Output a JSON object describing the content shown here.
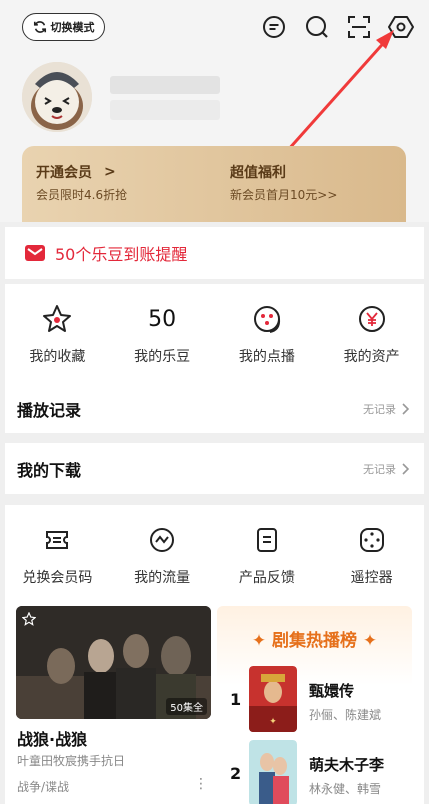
{
  "header": {
    "mode_switch_label": "切换模式",
    "icons": [
      "message-icon",
      "search-icon",
      "scan-icon",
      "settings-icon"
    ]
  },
  "vip": {
    "open_title": "开通会员",
    "open_arrow": ">",
    "open_sub": "会员限时4.6折抢",
    "benefit_title": "超值福利",
    "benefit_sub": "新会员首月10元>>"
  },
  "reminder": {
    "text": "50个乐豆到账提醒"
  },
  "quick": [
    {
      "label": "我的收藏",
      "icon": "star-icon"
    },
    {
      "label": "我的乐豆",
      "value": "50"
    },
    {
      "label": "我的点播",
      "icon": "film-reel-icon"
    },
    {
      "label": "我的资产",
      "icon": "yen-coin-icon"
    }
  ],
  "history": {
    "title": "播放记录",
    "status": "无记录"
  },
  "downloads": {
    "title": "我的下载",
    "status": "无记录"
  },
  "tools": [
    {
      "label": "兑换会员码",
      "icon": "ticket-icon"
    },
    {
      "label": "我的流量",
      "icon": "traffic-icon"
    },
    {
      "label": "产品反馈",
      "icon": "feedback-icon"
    },
    {
      "label": "遥控器",
      "icon": "remote-icon"
    }
  ],
  "featured": {
    "badge": "50集全",
    "title": "战狼·战狼",
    "desc": "叶童田牧宸携手抗日",
    "tags": "战争/谍战",
    "more": "⋮"
  },
  "ranking": {
    "title": "剧集热播榜",
    "items": [
      {
        "rank": "1",
        "name": "甄嬛传",
        "cast": "孙俪、陈建斌"
      },
      {
        "rank": "2",
        "name": "萌夫木子李",
        "cast": "林永健、韩雪"
      }
    ]
  },
  "colors": {
    "accent_red": "#e3283a",
    "rank_orange": "#e6701b",
    "vip_gold": "#d9b98c"
  }
}
